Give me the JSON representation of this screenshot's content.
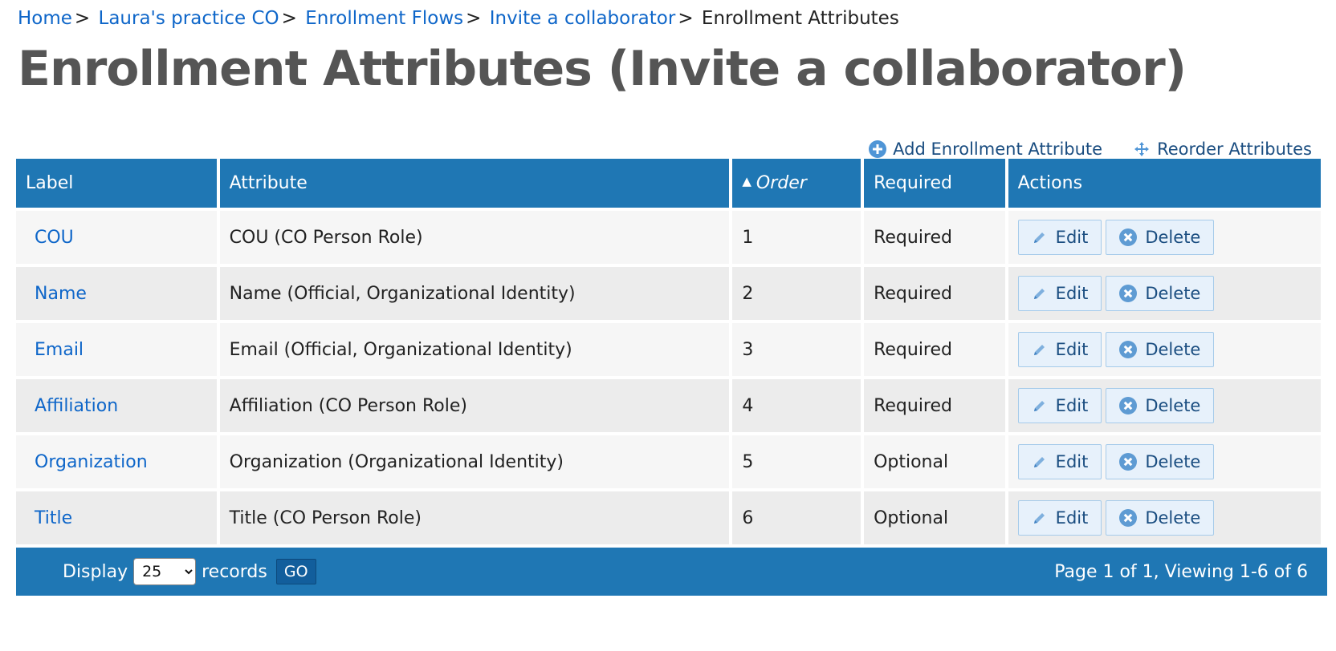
{
  "breadcrumb": {
    "items": [
      "Home",
      "Laura's practice CO",
      "Enrollment Flows",
      "Invite a collaborator"
    ],
    "current": "Enrollment Attributes",
    "separator": ">"
  },
  "page_title": "Enrollment Attributes (Invite a collaborator)",
  "actions": {
    "add_label": "Add Enrollment Attribute",
    "reorder_label": "Reorder Attributes"
  },
  "table": {
    "headers": {
      "label": "Label",
      "attribute": "Attribute",
      "order": "Order",
      "required": "Required",
      "actions": "Actions"
    },
    "sort_arrow": "▲",
    "edit_label": "Edit",
    "delete_label": "Delete",
    "rows": [
      {
        "label": "COU",
        "attribute": "COU (CO Person Role)",
        "order": "1",
        "required": "Required"
      },
      {
        "label": "Name",
        "attribute": "Name (Official, Organizational Identity)",
        "order": "2",
        "required": "Required"
      },
      {
        "label": "Email",
        "attribute": "Email (Official, Organizational Identity)",
        "order": "3",
        "required": "Required"
      },
      {
        "label": "Affiliation",
        "attribute": "Affiliation (CO Person Role)",
        "order": "4",
        "required": "Required"
      },
      {
        "label": "Organization",
        "attribute": "Organization (Organizational Identity)",
        "order": "5",
        "required": "Optional"
      },
      {
        "label": "Title",
        "attribute": "Title (CO Person Role)",
        "order": "6",
        "required": "Optional"
      }
    ]
  },
  "pager": {
    "display_label": "Display",
    "records_per_page": "25",
    "records_label": "records",
    "go_label": "GO",
    "summary": "Page 1 of 1, Viewing 1-6 of 6"
  },
  "colors": {
    "header_bg": "#1f77b4",
    "link": "#0e66c9",
    "button_bg": "#e7f1fb"
  }
}
